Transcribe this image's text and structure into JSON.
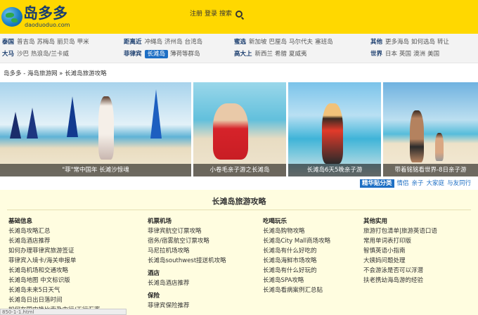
{
  "header": {
    "logo_title": "岛多多",
    "logo_sub": "daoduoduo.com",
    "links": [
      "注册",
      "登录",
      "搜索"
    ]
  },
  "nav": {
    "rows": [
      [
        {
          "title": "泰国",
          "items": [
            "普吉岛",
            "苏梅岛",
            "丽贝岛",
            "甲米"
          ]
        },
        {
          "title": "距离近",
          "items": [
            "冲绳岛",
            "济州岛",
            "台湾岛"
          ]
        },
        {
          "title": "蜜选",
          "items": [
            "新加坡",
            "巴厘岛",
            "马尔代夫",
            "塞班岛"
          ]
        },
        {
          "title": "其他",
          "items": [
            "更多海岛",
            "如何选岛",
            "转让"
          ]
        }
      ],
      [
        {
          "title": "大马",
          "items": [
            "沙巴",
            "热浪岛/兰卡威"
          ]
        },
        {
          "title": "菲律宾",
          "items": [
            "长滩岛",
            "薄荷等群岛"
          ],
          "active": "长滩岛"
        },
        {
          "title": "高大上",
          "items": [
            "新西兰",
            "希腊",
            "夏威夷"
          ]
        },
        {
          "title": "世界",
          "items": [
            "日本",
            "英国",
            "澳洲",
            "美国"
          ]
        }
      ]
    ]
  },
  "breadcrumb": "岛多多 - 海岛旅游网 » 长滩岛旅游攻略",
  "photos": [
    {
      "caption": "\"菲\"常中国年 长滩沙惊魂"
    },
    {
      "caption": "小卷毛亲子游之长滩岛"
    },
    {
      "caption": "长滩岛6天5晚亲子游"
    },
    {
      "caption": "带着铭铭看世界-8日亲子游"
    }
  ],
  "tags": {
    "main": "精华贴分类",
    "items": [
      "情侣",
      "亲子",
      "大家庭",
      "与友同行"
    ]
  },
  "guide": {
    "title": "长滩岛旅游攻略",
    "columns": [
      {
        "sections": [
          {
            "title": "基础信息",
            "items": [
              "长滩岛攻略汇总",
              "长滩岛酒店推荐",
              "如何办理菲律宾旅游签证",
              "菲律宾入境卡/海关申报单",
              "长滩岛机场和交通攻略",
              "长滩岛地图 中文标识版",
              "长滩岛未来5日天气",
              "长滩岛日出日落时间",
              "如何在国内换比索及中行/工行汇率"
            ]
          }
        ]
      },
      {
        "sections": [
          {
            "title": "机票机场",
            "items": [
              "菲律宾航空订票攻略",
              "宿务/宿雾航空订票攻略",
              "马尼拉机场攻略",
              "长滩岛southwest接送机攻略"
            ]
          },
          {
            "title": "酒店",
            "items": [
              "长滩岛酒店推荐"
            ]
          },
          {
            "title": "保险",
            "items": [
              "菲律宾保险推荐"
            ]
          }
        ]
      },
      {
        "sections": [
          {
            "title": "吃喝玩乐",
            "items": [
              "长滩岛购物攻略",
              "长滩岛City Mall商场攻略",
              "长滩岛有什么好吃的",
              "长滩岛海鲜市场攻略",
              "长滩岛有什么好玩的",
              "长滩岛SPA攻略",
              "长滩岛看病案例汇总贴"
            ]
          }
        ]
      },
      {
        "sections": [
          {
            "title": "其他实用",
            "items": [
              "旅游打包清单|旅游英语口语",
              "常用单词表打印版",
              "智慎英语小指南",
              "大姨妈问题处理",
              "不会游泳是否可以浮潜",
              "扶老携幼海岛游的经验"
            ]
          }
        ]
      }
    ]
  },
  "status": "850-1-1.html",
  "colors": {
    "header_bg": "#ffd800",
    "brand": "#1a3d6e",
    "accent": "#1e6fc4",
    "guide_bg": "#fffde0"
  }
}
